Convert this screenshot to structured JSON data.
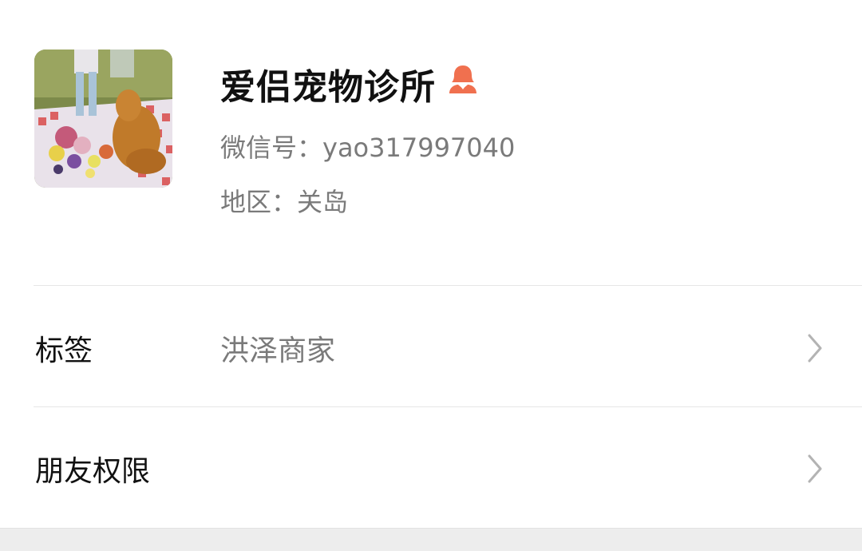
{
  "profile": {
    "name": "爱侣宠物诊所",
    "wechat_id": "微信号：yao317997040",
    "region": "地区：关岛",
    "gender_icon": "female-person-icon",
    "gender_color": "#f0704f"
  },
  "rows": [
    {
      "label": "标签",
      "value": "洪泽商家"
    },
    {
      "label": "朋友权限",
      "value": ""
    }
  ]
}
